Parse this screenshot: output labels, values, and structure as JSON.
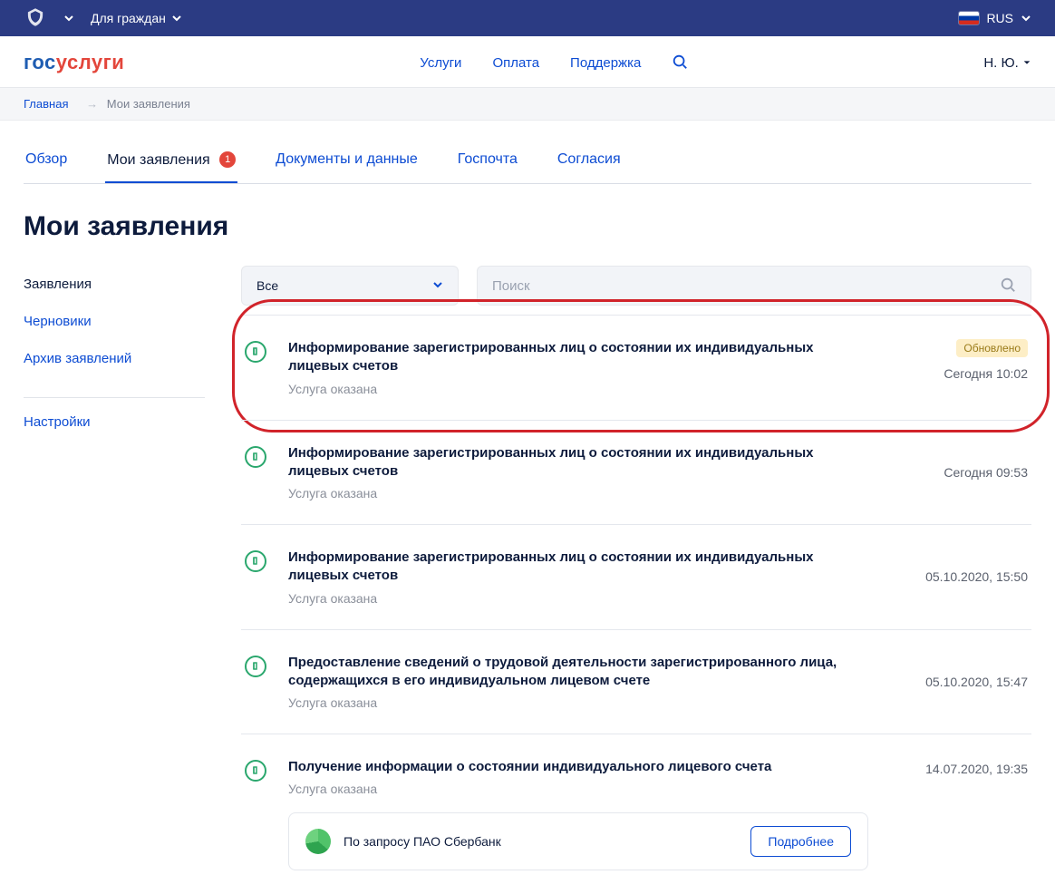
{
  "govbar": {
    "audience": "Для граждан",
    "lang_code": "RUS"
  },
  "logo": {
    "p1": "гос",
    "p2": "услуги"
  },
  "nav": {
    "services": "Услуги",
    "payment": "Оплата",
    "support": "Поддержка"
  },
  "user": {
    "name": "Н. Ю."
  },
  "breadcrumb": {
    "home": "Главная",
    "current": "Мои заявления"
  },
  "tabs": {
    "overview": "Обзор",
    "apps": "Мои заявления",
    "apps_count": "1",
    "docs": "Документы и данные",
    "mail": "Госпочта",
    "consent": "Согласия"
  },
  "page_title": "Мои заявления",
  "side": {
    "apps": "Заявления",
    "drafts": "Черновики",
    "archive": "Архив заявлений",
    "settings": "Настройки"
  },
  "filter": {
    "all": "Все",
    "search_placeholder": "Поиск"
  },
  "status_done": "Услуга оказана",
  "updated_badge": "Обновлено",
  "items": [
    {
      "title": "Информирование зарегистрированных лиц о состоянии их индивидуальных лицевых счетов",
      "time": "Сегодня 10:02",
      "updated": true
    },
    {
      "title": "Информирование зарегистрированных лиц о состоянии их индивидуальных лицевых счетов",
      "time": "Сегодня 09:53"
    },
    {
      "title": "Информирование зарегистрированных лиц о состоянии их индивидуальных лицевых счетов",
      "time": "05.10.2020, 15:50"
    },
    {
      "title": "Предоставление сведений о трудовой деятельности зарегистрированного лица, содержащихся в его индивидуальном лицевом счете",
      "time": "05.10.2020, 15:47"
    },
    {
      "title": "Получение информации о состоянии индивидуального лицевого счета",
      "time": "14.07.2020, 19:35"
    }
  ],
  "request_card": {
    "text": "По запросу ПАО Сбербанк",
    "more": "Подробнее"
  }
}
